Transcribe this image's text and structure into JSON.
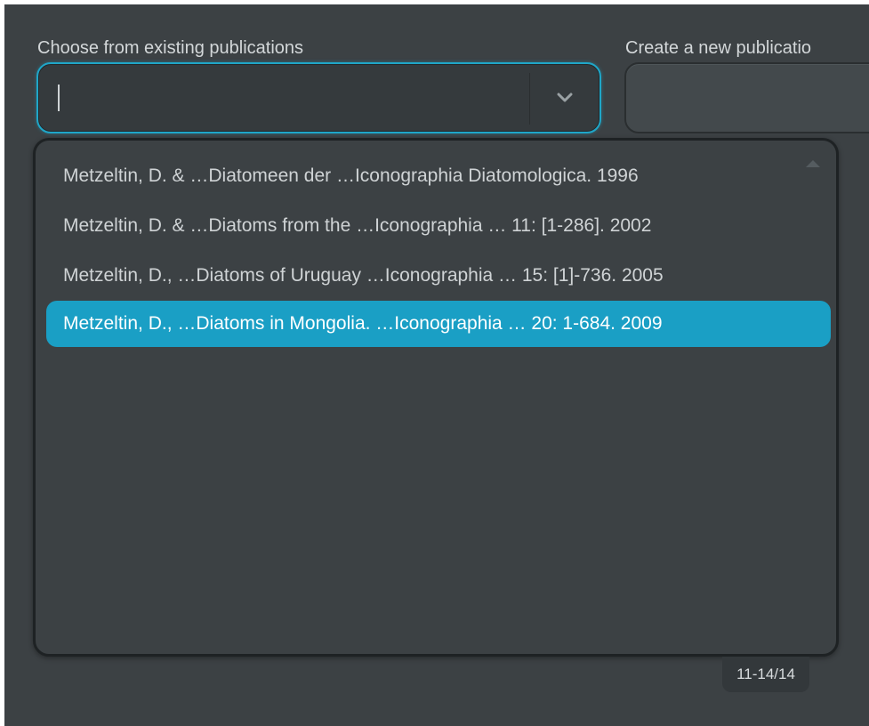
{
  "choose_section": {
    "label": "Choose from existing publications",
    "input_value": "",
    "toggle_icon": "chevron-down-icon"
  },
  "create_section": {
    "label": "Create a new publicatio"
  },
  "dropdown": {
    "options": [
      "Metzeltin, D. & …Diatomeen der …Iconographia Diatomologica. 1996",
      "Metzeltin, D. & …Diatoms from the …Iconographia … 11: [1-286]. 2002",
      "Metzeltin, D., …Diatoms of Uruguay …Iconographia … 15: [1]-736. 2005",
      "Metzeltin, D., …Diatoms in Mongolia. …Iconographia … 20: 1-684. 2009"
    ],
    "selected_index": 3,
    "scroll_icon": "scroll-up-arrow-icon"
  },
  "counter": {
    "text": "11-14/14"
  },
  "colors": {
    "background": "#3c4144",
    "accent": "#1a9fc5",
    "text": "#cfd3d5"
  }
}
